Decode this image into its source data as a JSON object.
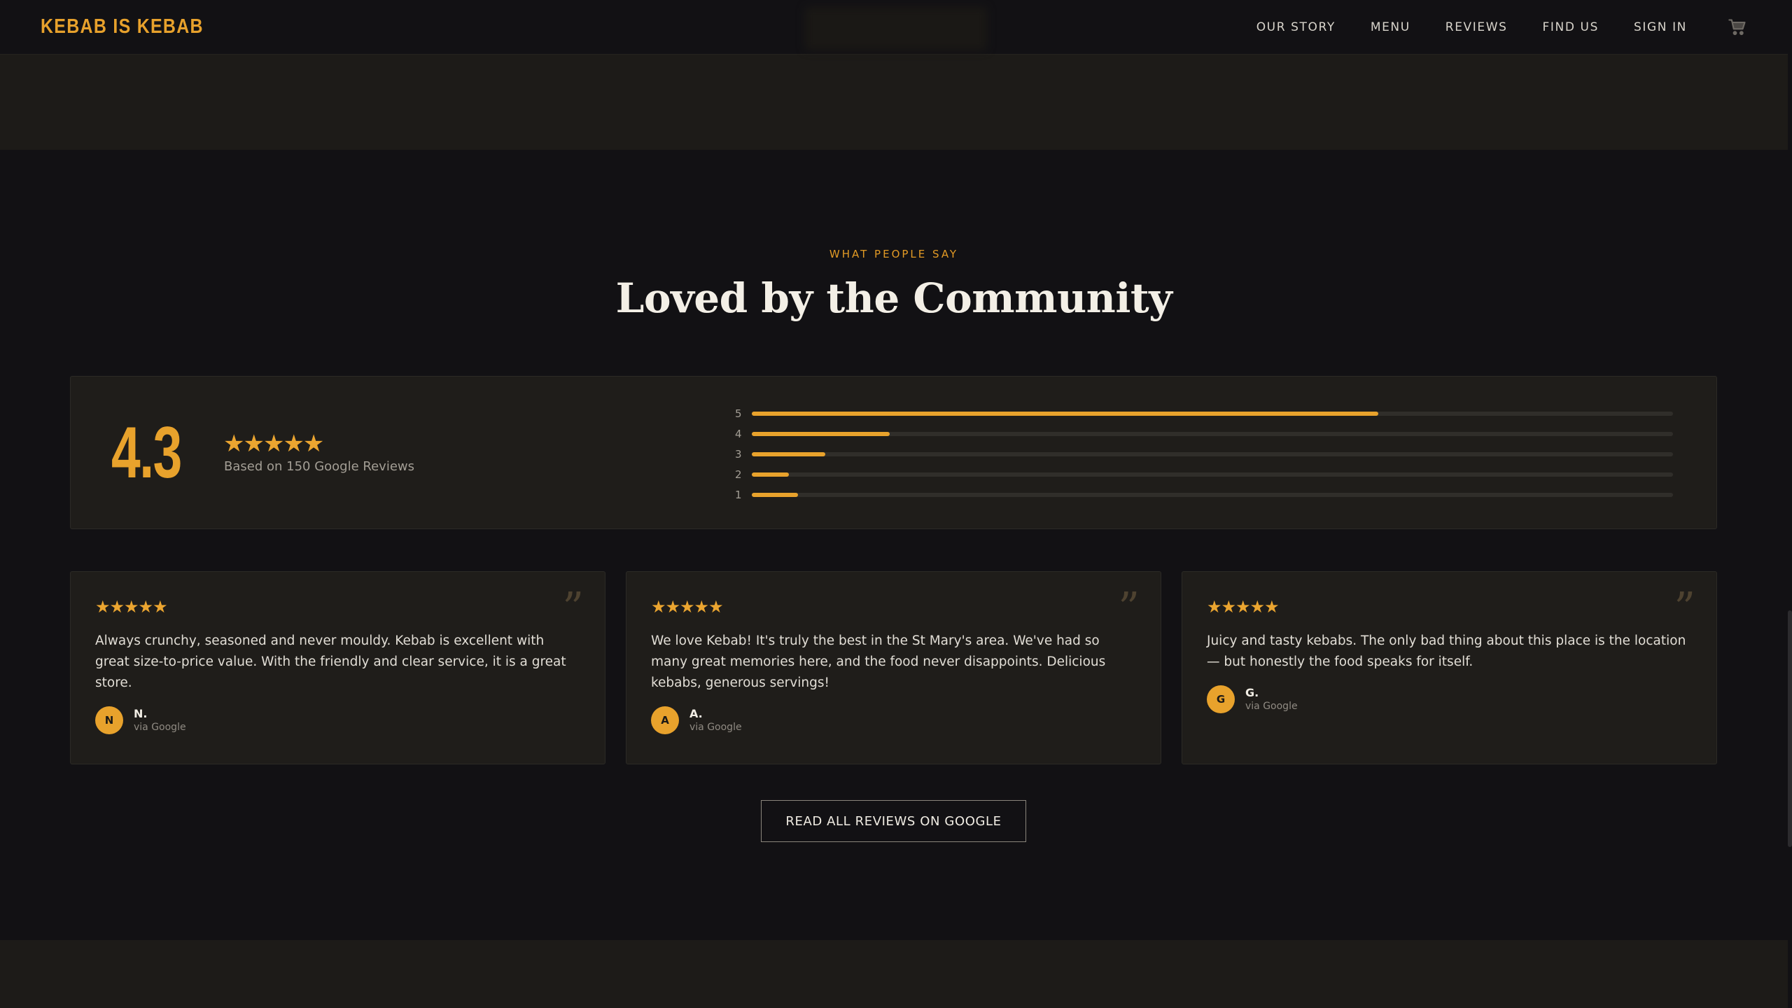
{
  "nav": {
    "logo": "KEBAB IS KEBAB",
    "links": [
      "OUR STORY",
      "MENU",
      "REVIEWS",
      "FIND US",
      "SIGN IN"
    ],
    "cart_icon": "cart-icon"
  },
  "section": {
    "eyebrow": "WHAT PEOPLE SAY",
    "heading": "Loved by the Community"
  },
  "summary": {
    "rating": "4.3",
    "stars": "★★★★★",
    "basis": "Based on 150 Google Reviews",
    "distribution": [
      {
        "label": "5",
        "fraction": 0.68
      },
      {
        "label": "4",
        "fraction": 0.15
      },
      {
        "label": "3",
        "fraction": 0.08
      },
      {
        "label": "2",
        "fraction": 0.04
      },
      {
        "label": "1",
        "fraction": 0.05
      }
    ]
  },
  "reviews": [
    {
      "stars": "★★★★★",
      "text": "Always crunchy, seasoned and never mouldy. Kebab is excellent with great size-to-price value. With the friendly and clear service, it is a great store.",
      "initial": "N",
      "name": "N.",
      "source": "via Google"
    },
    {
      "stars": "★★★★★",
      "text": "We love Kebab! It's truly the best in the St Mary's area. We've had so many great memories here, and the food never disappoints. Delicious kebabs, generous servings!",
      "initial": "A",
      "name": "A.",
      "source": "via Google"
    },
    {
      "stars": "★★★★★",
      "text": "Juicy and tasty kebabs. The only bad thing about this place is the location — but honestly the food speaks for itself.",
      "initial": "G",
      "name": "G.",
      "source": "via Google"
    }
  ],
  "cta": {
    "label": "READ ALL REVIEWS ON GOOGLE"
  },
  "colors": {
    "accent": "#e8a22c",
    "background": "#121114",
    "card": "#1f1d1a"
  }
}
